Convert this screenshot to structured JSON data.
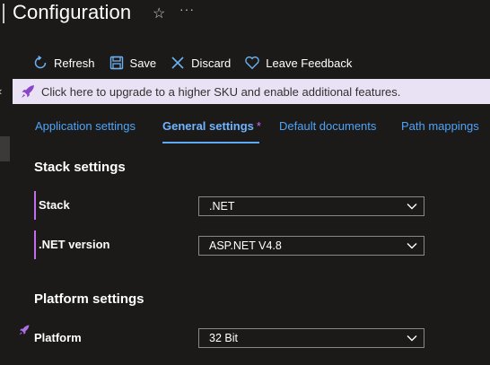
{
  "header": {
    "title": "Configuration",
    "favorite_icon": "star-icon",
    "more_icon": "more-horizontal-icon"
  },
  "toolbar": {
    "refresh_label": "Refresh",
    "save_label": "Save",
    "discard_label": "Discard",
    "feedback_label": "Leave Feedback"
  },
  "banner": {
    "text": "Click here to upgrade to a higher SKU and enable additional features.",
    "icon": "rocket-icon"
  },
  "tabs": [
    {
      "label": "Application settings",
      "active": false
    },
    {
      "label": "General settings",
      "active": true,
      "modified_marker": "*"
    },
    {
      "label": "Default documents",
      "active": false
    },
    {
      "label": "Path mappings",
      "active": false
    }
  ],
  "stack_settings": {
    "heading": "Stack settings",
    "stack": {
      "label": "Stack",
      "value": ".NET"
    },
    "net_version": {
      "label": ".NET version",
      "value": "ASP.NET V4.8"
    }
  },
  "platform_settings": {
    "heading": "Platform settings",
    "platform": {
      "label": "Platform",
      "value": "32 Bit"
    }
  },
  "colors": {
    "background": "#1b1a19",
    "link": "#4fa3f7",
    "accent_purple": "#c36dec",
    "banner_bg": "#e9e1f4"
  }
}
